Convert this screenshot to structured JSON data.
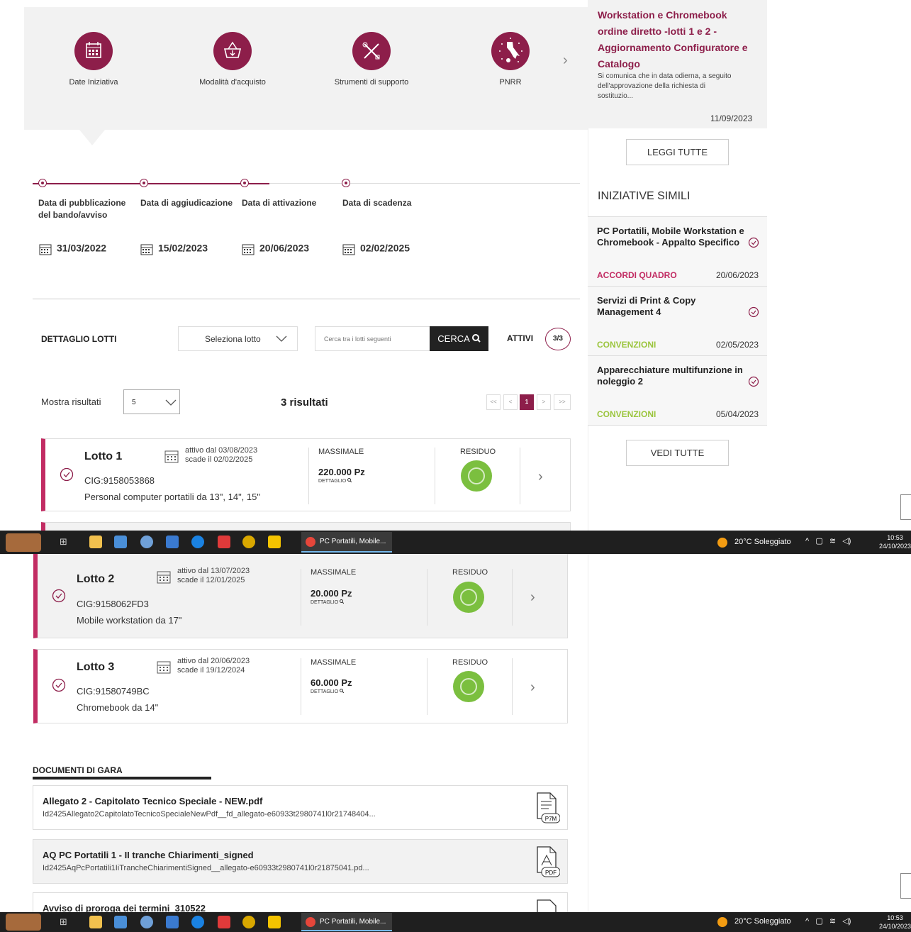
{
  "nav_icons": [
    {
      "label": "Date Iniziativa",
      "icon": "calendar-icon"
    },
    {
      "label": "Modalità d'acquisto",
      "icon": "basket-icon"
    },
    {
      "label": "Strumenti di supporto",
      "icon": "tools-icon"
    },
    {
      "label": "PNRR",
      "icon": "italy-map-icon"
    }
  ],
  "timeline": [
    {
      "label": "Data di pubblicazione del bando/avviso",
      "date": "31/03/2022"
    },
    {
      "label": "Data di aggiudicazione",
      "date": "15/02/2023"
    },
    {
      "label": "Data di attivazione",
      "date": "20/06/2023"
    },
    {
      "label": "Data di scadenza",
      "date": "02/02/2025"
    }
  ],
  "lotti_bar": {
    "title": "DETTAGLIO LOTTI",
    "select": "Seleziona lotto",
    "search_placeholder": "Cerca tra i lotti seguenti",
    "search_btn": "CERCA",
    "attivi": "ATTIVI",
    "count": "3/3"
  },
  "results": {
    "show_label": "Mostra risultati",
    "page_size": "5",
    "count": "3 risultati",
    "page": "1",
    "first": "<<",
    "prev": "<",
    "next": ">",
    "last": ">>"
  },
  "lots": [
    {
      "name": "Lotto 1",
      "active": "attivo dal 03/08/2023",
      "expires": "scade il 02/02/2025",
      "cig": "CIG:9158053868",
      "desc": "Personal computer portatili da 13\", 14\", 15\"",
      "massimale_label": "MASSIMALE",
      "massimale": "220.000 Pz",
      "dettaglio": "DETTAGLIO",
      "residuo": "RESIDUO"
    },
    {
      "name": "Lotto 2",
      "active": "attivo dal 13/07/2023",
      "expires": "scade il 12/01/2025",
      "cig": "CIG:9158062FD3",
      "desc": "Mobile workstation da 17\"",
      "massimale_label": "MASSIMALE",
      "massimale": "20.000 Pz",
      "dettaglio": "DETTAGLIO",
      "residuo": "RESIDUO"
    },
    {
      "name": "Lotto 3",
      "active": "attivo dal 20/06/2023",
      "expires": "scade il 19/12/2024",
      "cig": "CIG:91580749BC",
      "desc": "Chromebook da 14\"",
      "massimale_label": "MASSIMALE",
      "massimale": "60.000 Pz",
      "dettaglio": "DETTAGLIO",
      "residuo": "RESIDUO"
    }
  ],
  "sidebar": {
    "news_title": "Workstation e Chromebook ordine diretto -lotti 1 e 2 - Aggiornamento Configuratore e Catalogo",
    "news_text": "Si comunica che in data odierna, a seguito dell'approvazione della richiesta di sostituzio...",
    "news_date": "11/09/2023",
    "read_all": "LEGGI TUTTE",
    "similar_title": "INIZIATIVE SIMILI",
    "similar": [
      {
        "title": "PC Portatili, Mobile Workstation e Chromebook - Appalto Specifico",
        "cat": "ACCORDI QUADRO",
        "date": "20/06/2023",
        "color": "#c22c63"
      },
      {
        "title": "Servizi di Print & Copy Management 4",
        "cat": "CONVENZIONI",
        "date": "02/05/2023",
        "color": "#9bc53d"
      },
      {
        "title": "Apparecchiature multifunzione in noleggio 2",
        "cat": "CONVENZIONI",
        "date": "05/04/2023",
        "color": "#9bc53d"
      }
    ],
    "see_all": "VEDI TUTTE"
  },
  "documents": {
    "title": "DOCUMENTI DI GARA",
    "items": [
      {
        "title": "Allegato 2 - Capitolato Tecnico Speciale - NEW.pdf",
        "path": "Id2425Allegato2CapitolatoTecnicoSpecialeNewPdf__fd_allegato-e60933t2980741l0r21748404...",
        "type": "P7M"
      },
      {
        "title": "AQ PC Portatili 1 - II tranche Chiarimenti_signed",
        "path": "Id2425AqPcPortatili1IiTrancheChiarimentiSigned__allegato-e60933t2980741l0r21875041.pd...",
        "type": "PDF"
      },
      {
        "title": "Avviso di proroga dei termini_310522",
        "path": "",
        "type": ""
      }
    ]
  },
  "taskbar": {
    "app": "PC Portatili, Mobile...",
    "weather": "20°C  Soleggiato",
    "time": "10:53",
    "date": "24/10/2023"
  },
  "colors": {
    "accent": "#8d1e4a",
    "magenta": "#c22c63",
    "green": "#7bbf3f",
    "dark": "#222222"
  }
}
